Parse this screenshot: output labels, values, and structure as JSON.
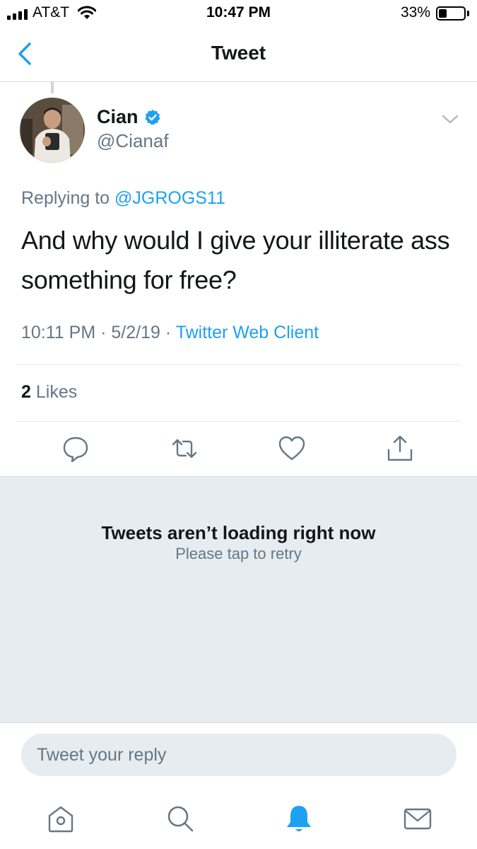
{
  "status_bar": {
    "carrier": "AT&T",
    "time": "10:47 PM",
    "battery_percent": "33%",
    "battery_level": 0.33,
    "icons": [
      "signal-icon",
      "wifi-icon",
      "battery-icon"
    ]
  },
  "nav": {
    "title": "Tweet",
    "back_icon": "chevron-left-icon"
  },
  "tweet": {
    "author": {
      "name": "Cian",
      "handle": "@Cianaf",
      "verified": true
    },
    "replying_prefix": "Replying to",
    "replying_to": "@JGROGS11",
    "text": "And why would I give your illiterate ass something for free?",
    "time": "10:11 PM",
    "date": "5/2/19",
    "separator": "·",
    "client": "Twitter Web Client",
    "likes_count": "2",
    "likes_label": "Likes",
    "actions": [
      "reply-icon",
      "retweet-icon",
      "like-icon",
      "share-icon"
    ]
  },
  "load_error": {
    "title": "Tweets aren’t loading right now",
    "subtitle": "Please tap to retry"
  },
  "reply": {
    "placeholder": "Tweet your reply"
  },
  "tabbar": {
    "tabs": [
      "home-icon",
      "search-icon",
      "notifications-icon",
      "messages-icon"
    ],
    "active": "notifications-icon"
  },
  "colors": {
    "accent": "#1da1f2",
    "secondary_text": "#657786",
    "primary_text": "#14171a",
    "background_gray": "#e6ecf0",
    "divider": "#e1e8ed"
  }
}
